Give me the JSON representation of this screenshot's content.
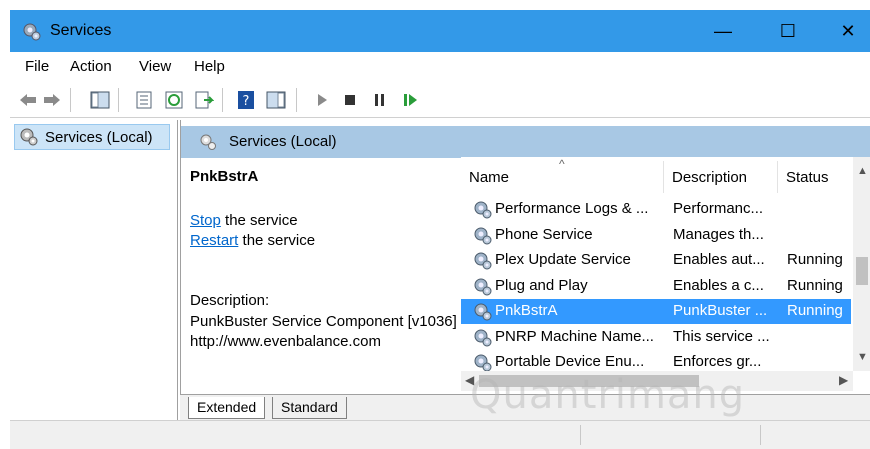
{
  "window": {
    "title": "Services",
    "minimize_glyph": "—",
    "maximize_glyph": "☐",
    "close_glyph": "✕"
  },
  "menu": {
    "items": [
      "File",
      "Action",
      "View",
      "Help"
    ]
  },
  "tree": {
    "item_label": "Services (Local)"
  },
  "panel": {
    "header": "Services (Local)",
    "selected_service": "PnkBstrA",
    "stop_link": "Stop",
    "stop_suffix": " the service",
    "restart_link": "Restart",
    "restart_suffix": " the service",
    "description_label": "Description:",
    "description_text": "PunkBuster Service Component [v1036] http://www.evenbalance.com"
  },
  "list": {
    "columns": [
      "Name",
      "Description",
      "Status"
    ],
    "rows": [
      {
        "name": "Performance Logs & ...",
        "description": "Performanc...",
        "status": ""
      },
      {
        "name": "Phone Service",
        "description": "Manages th...",
        "status": ""
      },
      {
        "name": "Plex Update Service",
        "description": "Enables aut...",
        "status": "Running"
      },
      {
        "name": "Plug and Play",
        "description": "Enables a c...",
        "status": "Running"
      },
      {
        "name": "PnkBstrA",
        "description": "PunkBuster ...",
        "status": "Running"
      },
      {
        "name": "PNRP Machine Name...",
        "description": "This service ...",
        "status": ""
      },
      {
        "name": "Portable Device Enu...",
        "description": "Enforces gr...",
        "status": ""
      }
    ],
    "selected_index": 4
  },
  "tabs": [
    "Extended",
    "Standard"
  ],
  "watermark": "Quantrimang",
  "colors": {
    "titlebar": "#3399e8",
    "selection": "#3399ff",
    "link": "#0066cc",
    "panel_header": "#a8c8e4"
  }
}
